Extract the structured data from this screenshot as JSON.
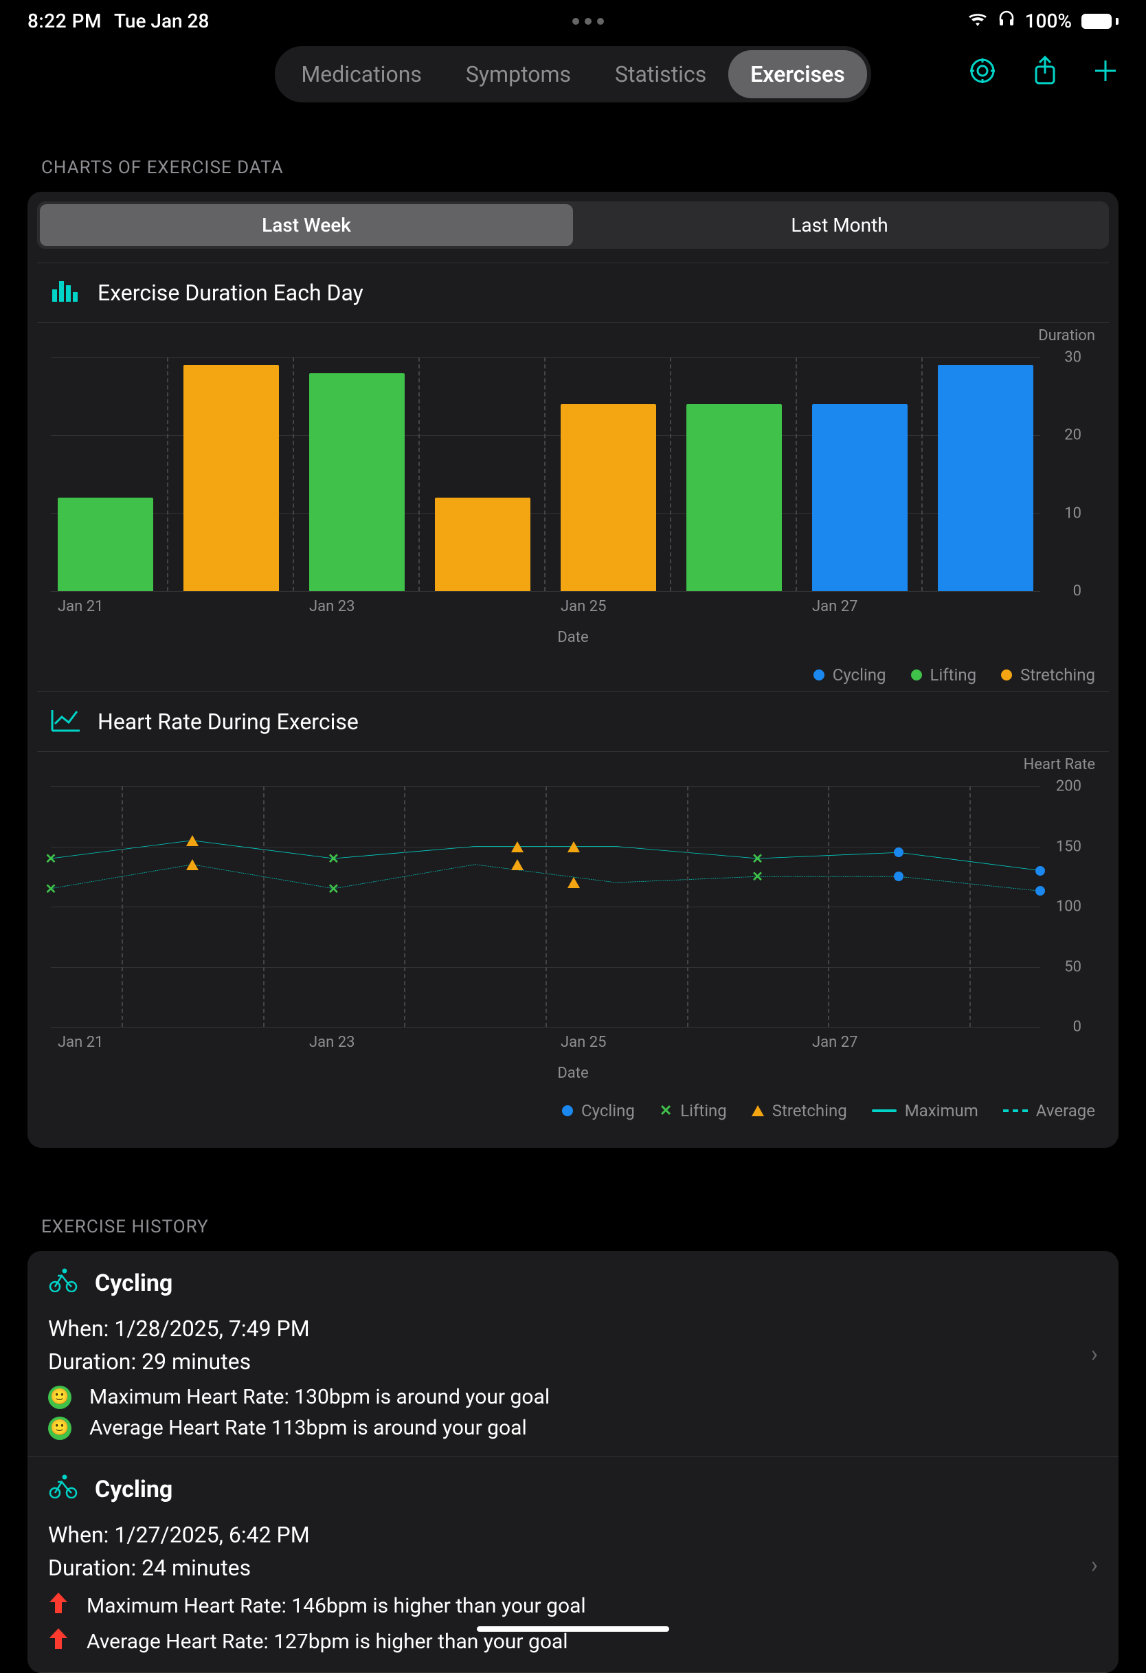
{
  "status": {
    "time": "8:22 PM",
    "date": "Tue Jan 28",
    "battery": "100%"
  },
  "nav": {
    "tabs": [
      "Medications",
      "Symptoms",
      "Statistics",
      "Exercises"
    ],
    "active": "Exercises"
  },
  "sections": {
    "charts_label": "CHARTS OF EXERCISE DATA",
    "history_label": "EXERCISE HISTORY"
  },
  "range": {
    "options": [
      "Last Week",
      "Last Month"
    ],
    "active": "Last Week"
  },
  "colors": {
    "cycling": "#1b88f0",
    "lifting": "#3fc14a",
    "stretching": "#f3a512",
    "accent": "#00d4c8",
    "green_face": "#3fc14a",
    "red_arrow": "#ff3b30"
  },
  "chart_data": [
    {
      "type": "bar",
      "title": "Exercise Duration Each Day",
      "xlabel": "Date",
      "ylabel": "Duration",
      "ylim": [
        0,
        30
      ],
      "yticks": [
        0,
        10,
        20,
        30
      ],
      "categories": [
        "Jan 21",
        "Jan 22",
        "Jan 23",
        "Jan 24",
        "Jan 25",
        "Jan 26",
        "Jan 27",
        "Jan 28"
      ],
      "x_tick_labels": [
        "Jan 21",
        "",
        "Jan 23",
        "",
        "Jan 25",
        "",
        "Jan 27",
        ""
      ],
      "bars": [
        {
          "category": "Jan 21",
          "type": "Lifting",
          "value": 12
        },
        {
          "category": "Jan 22",
          "type": "Stretching",
          "value": 29
        },
        {
          "category": "Jan 23",
          "type": "Lifting",
          "value": 28
        },
        {
          "category": "Jan 24",
          "type": "Stretching",
          "value": 12
        },
        {
          "category": "Jan 25",
          "type": "Stretching",
          "value": 24
        },
        {
          "category": "Jan 26",
          "type": "Lifting",
          "value": 24
        },
        {
          "category": "Jan 27",
          "type": "Cycling",
          "value": 24
        },
        {
          "category": "Jan 28",
          "type": "Cycling",
          "value": 29
        }
      ],
      "legend": [
        "Cycling",
        "Lifting",
        "Stretching"
      ]
    },
    {
      "type": "line",
      "title": "Heart Rate During Exercise",
      "xlabel": "Date",
      "ylabel": "Heart Rate",
      "ylim": [
        0,
        200
      ],
      "yticks": [
        0,
        50,
        100,
        150,
        200
      ],
      "x": [
        "Jan 21",
        "Jan 22",
        "Jan 23",
        "Jan 24",
        "Jan 25",
        "Jan 26",
        "Jan 27",
        "Jan 28"
      ],
      "x_tick_labels": [
        "Jan 21",
        "",
        "Jan 23",
        "",
        "Jan 25",
        "",
        "Jan 27",
        ""
      ],
      "series": [
        {
          "name": "Maximum",
          "style": "solid",
          "color": "#00d4c8",
          "values": [
            140,
            155,
            140,
            150,
            150,
            140,
            145,
            130
          ]
        },
        {
          "name": "Average",
          "style": "dashed",
          "color": "#00d4c8",
          "values": [
            115,
            135,
            115,
            135,
            120,
            125,
            125,
            113
          ]
        }
      ],
      "markers": [
        {
          "type": "Lifting",
          "x": "Jan 21",
          "max": 140,
          "avg": 115
        },
        {
          "type": "Stretching",
          "x": "Jan 22",
          "max": 155,
          "avg": 135
        },
        {
          "type": "Lifting",
          "x": "Jan 23",
          "max": 140,
          "avg": 115
        },
        {
          "type": "Stretching",
          "x": "Jan 24.3",
          "max": 150,
          "avg": 135
        },
        {
          "type": "Stretching",
          "x": "Jan 24.7",
          "max": 150,
          "avg": 120
        },
        {
          "type": "Lifting",
          "x": "Jan 26",
          "max": 140,
          "avg": 125
        },
        {
          "type": "Cycling",
          "x": "Jan 27",
          "max": 145,
          "avg": 125
        },
        {
          "type": "Cycling",
          "x": "Jan 28",
          "max": 130,
          "avg": 113
        }
      ],
      "legend_markers": [
        "Cycling",
        "Lifting",
        "Stretching"
      ],
      "legend_lines": [
        "Maximum",
        "Average"
      ]
    }
  ],
  "history": [
    {
      "type": "Cycling",
      "when": "When: 1/28/2025, 7:49 PM",
      "duration": "Duration: 29 minutes",
      "max_hr": "Maximum Heart Rate: 130bpm is around your goal",
      "avg_hr": "Average Heart Rate 113bpm is around your goal",
      "status": "good"
    },
    {
      "type": "Cycling",
      "when": "When: 1/27/2025, 6:42 PM",
      "duration": "Duration: 24 minutes",
      "max_hr": "Maximum Heart Rate: 146bpm is higher than your goal",
      "avg_hr": "Average Heart Rate: 127bpm is higher than your goal",
      "status": "high"
    }
  ]
}
